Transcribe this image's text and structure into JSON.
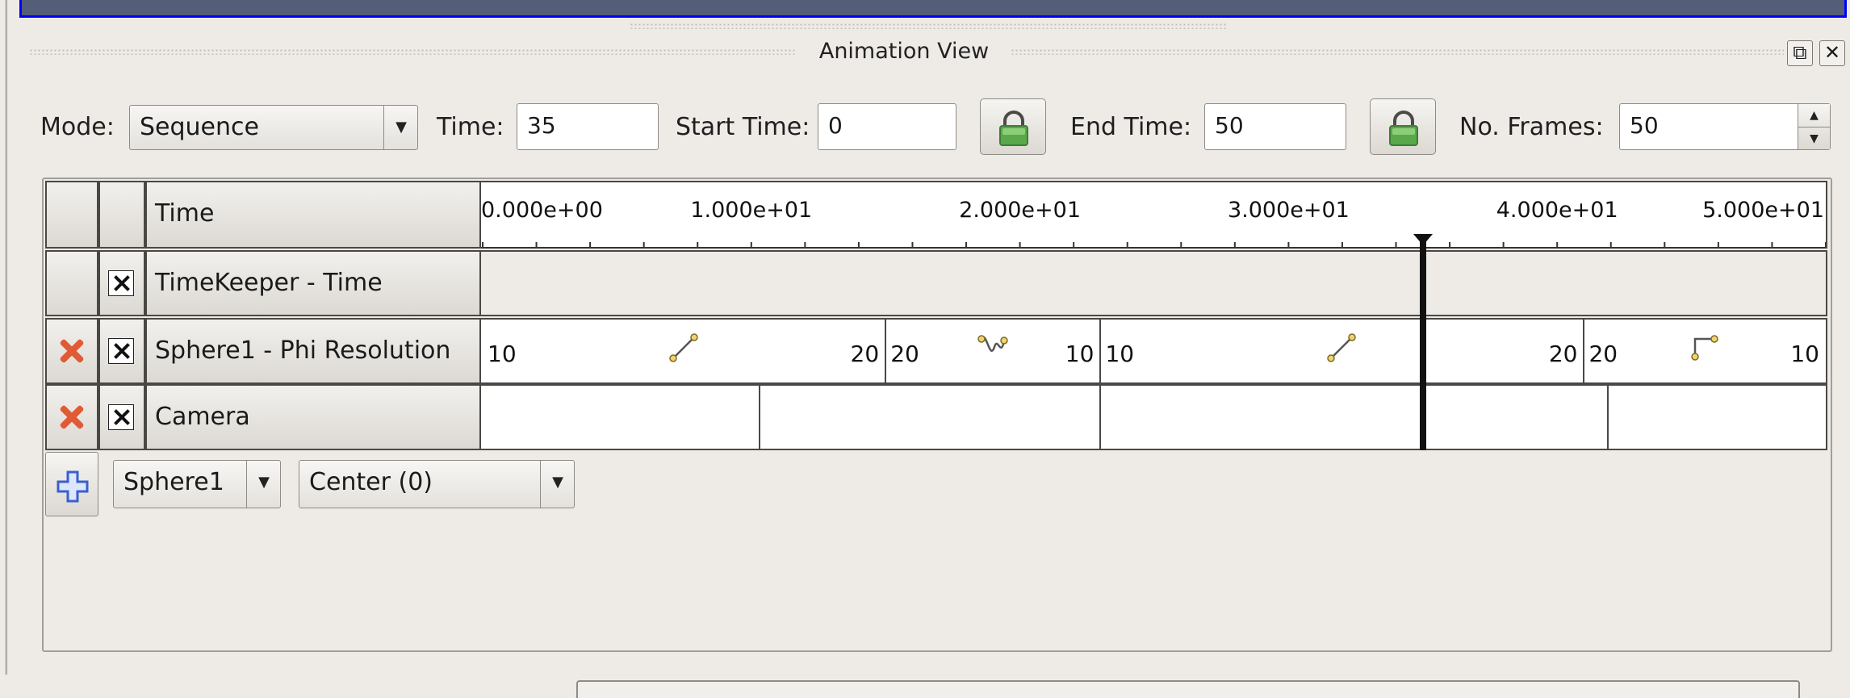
{
  "dock": {
    "title": "Animation View"
  },
  "toolbar": {
    "mode_label": "Mode:",
    "mode_value": "Sequence",
    "time_label": "Time:",
    "time_value": "35",
    "start_label": "Start Time:",
    "start_value": "0",
    "end_label": "End Time:",
    "end_value": "50",
    "frames_label": "No. Frames:",
    "frames_value": "50"
  },
  "timeline": {
    "header_label": "Time",
    "ticks": [
      "0.000e+00",
      "1.000e+01",
      "2.000e+01",
      "3.000e+01",
      "4.000e+01",
      "5.000e+01"
    ],
    "range": [
      0,
      50
    ],
    "current_time": 35
  },
  "tracks": [
    {
      "name": "TimeKeeper - Time",
      "removable": false,
      "enabled": true
    },
    {
      "name": "Sphere1 - Phi Resolution",
      "removable": true,
      "enabled": true,
      "keyframe_times": [
        0,
        15,
        23,
        41,
        50
      ],
      "segments": [
        {
          "start": "10",
          "end": "20",
          "interpolation": "linear"
        },
        {
          "start": "20",
          "end": "10",
          "interpolation": "sinusoid"
        },
        {
          "start": "10",
          "end": "20",
          "interpolation": "linear"
        },
        {
          "start": "20",
          "end": "10",
          "interpolation": "step"
        }
      ]
    },
    {
      "name": "Camera",
      "removable": true,
      "enabled": true,
      "keyframe_times": [
        0,
        10.3,
        23,
        41.9,
        50
      ]
    }
  ],
  "add_track": {
    "source": "Sphere1",
    "property": "Center (0)"
  },
  "icons": {
    "lock": "lock-icon",
    "remove": "remove-x-icon",
    "enable": "checkbox-x-icon",
    "add": "plus-icon",
    "float": "float-icon",
    "close": "close-icon",
    "lock_color": "#5aa84a",
    "remove_color": "#e05a36",
    "add_color": "#3a5fcd"
  }
}
